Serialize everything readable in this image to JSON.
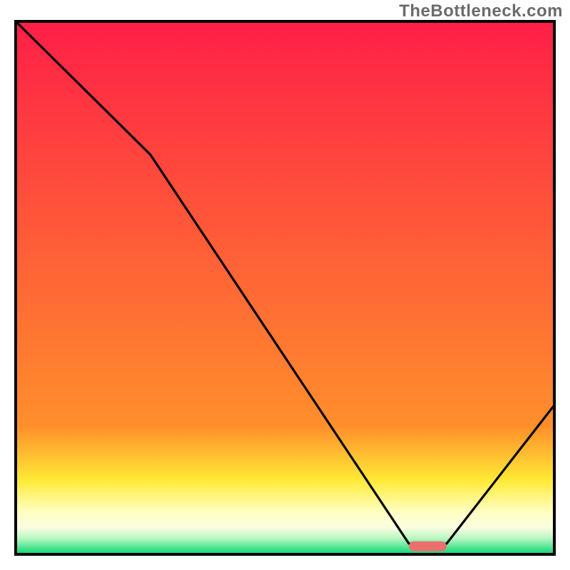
{
  "watermark": "TheBottleneck.com",
  "colors": {
    "red": "#ff1f47",
    "orange": "#ff8f2b",
    "yellow": "#ffe935",
    "pale": "#ffffc2",
    "cream": "#fafde0",
    "mint": "#b8f7c1",
    "green": "#00d670",
    "marker": "#e9706e",
    "frame": "#000000",
    "curve": "#000000"
  },
  "chart_data": {
    "type": "line",
    "title": "",
    "xlabel": "",
    "ylabel": "",
    "xlim": [
      0,
      100
    ],
    "ylim": [
      0,
      100
    ],
    "series": [
      {
        "name": "bottleneck-curve",
        "x": [
          0,
          25,
          73,
          80,
          100
        ],
        "values": [
          100,
          75,
          2,
          2,
          28
        ]
      }
    ],
    "marker": {
      "x_start": 73,
      "x_end": 80,
      "y": 1.5
    },
    "bands": [
      {
        "from": 100,
        "to": 24,
        "color_top": "red",
        "color_bot": "orange"
      },
      {
        "from": 24,
        "to": 14,
        "color_top": "orange",
        "color_bot": "yellow"
      },
      {
        "from": 14,
        "to": 8,
        "color_top": "yellow",
        "color_bot": "pale"
      },
      {
        "from": 8,
        "to": 5,
        "color_top": "pale",
        "color_bot": "cream"
      },
      {
        "from": 5,
        "to": 3,
        "color_top": "cream",
        "color_bot": "mint"
      },
      {
        "from": 3,
        "to": 0,
        "color_top": "mint",
        "color_bot": "green"
      }
    ]
  }
}
